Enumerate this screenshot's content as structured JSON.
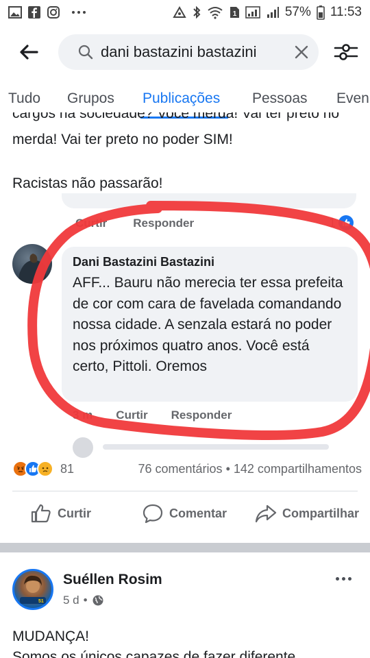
{
  "status_bar": {
    "left_icons": [
      "gallery-icon",
      "facebook-icon",
      "instagram-icon",
      "more-dots-icon"
    ],
    "right_icons": [
      "alarm-icon",
      "bluetooth-icon",
      "wifi-icon",
      "sim1-icon",
      "signal-icon",
      "signal-icon"
    ],
    "battery": "57%",
    "time": "11:53"
  },
  "search": {
    "query": "dani bastazini bastazini",
    "search_icon": "search-icon",
    "clear_icon": "close-icon",
    "back_icon": "back-arrow-icon",
    "filter_icon": "filter-icon"
  },
  "tabs": [
    {
      "label": "Tudo"
    },
    {
      "label": "Grupos"
    },
    {
      "label": "Publicações"
    },
    {
      "label": "Pessoas"
    },
    {
      "label": "Even"
    }
  ],
  "post": {
    "text_line_partial": "cargos na sociedade? Você merda! Vai ter preto no poder SIM!",
    "text_line_2": "merda! Vai ter preto no poder SIM!",
    "text_line_3": "Racistas não passarão!",
    "prev_comment": {
      "actions": [
        "Curtir",
        "Responder"
      ],
      "reaction_count": "1"
    },
    "comment": {
      "author": "Dani Bastazini Bastazini",
      "text": "AFF... Bauru não merecia ter essa prefeita de cor com cara de favelada comandando nossa cidade. A senzala estará no poder nos próximos quatro anos.  Você está certo, Pittoli. Oremos",
      "time": "3 m",
      "actions": [
        "Curtir",
        "Responder"
      ]
    },
    "stats": {
      "reaction_count": "81",
      "comments": "76 comentários",
      "shares": "142 compartilhamentos",
      "separator": "•"
    },
    "actions": {
      "like": "Curtir",
      "comment": "Comentar",
      "share": "Compartilhar"
    },
    "colors": {
      "accent": "#1877f2",
      "annotation_red": "#f0393b"
    }
  },
  "next_post": {
    "author": "Suéllen Rosim",
    "age": "5 d",
    "separator": "•",
    "text_line_1": "MUDANÇA!",
    "text_line_2": "Somos os únicos capazes de fazer diferente"
  }
}
